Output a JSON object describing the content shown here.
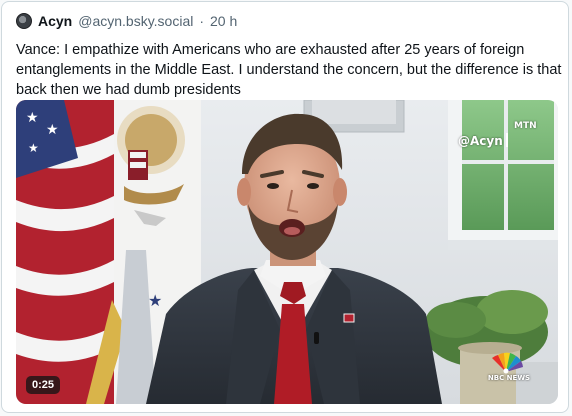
{
  "post": {
    "author_name": "Acyn",
    "author_handle": "@acyn.bsky.social",
    "separator": "·",
    "age": "20 h",
    "text": "Vance: I empathize with Americans who are exhausted after 25 years of foreign entanglements in the Middle East. I understand the concern, but the difference is that back then we had dumb presidents"
  },
  "video": {
    "duration": "0:25",
    "watermark_handle": "@Acyn",
    "watermark_mark": "MTN",
    "network_logo_text": "NBC NEWS"
  },
  "icons": {
    "avatar": "avatar-image",
    "network_logo": "nbc-peacock-icon"
  }
}
